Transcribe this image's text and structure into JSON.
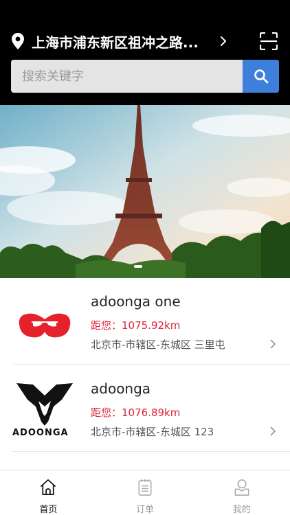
{
  "header": {
    "location": "上海市浦东新区祖冲之路...",
    "icons": {
      "pin": "location-pin-icon",
      "chevron": "chevron-right-icon",
      "scan": "scan-icon"
    }
  },
  "search": {
    "placeholder": "搜索关键字",
    "value": "",
    "button_icon": "search-icon",
    "accent": "#3f7fdc"
  },
  "banner": {
    "slide_count": 1,
    "active_slide": 1
  },
  "shops": [
    {
      "name": "adoonga one",
      "distance": "距您：1075.92km",
      "address": "北京市-市辖区-东城区 三里屯",
      "logo": "red-mustache-logo"
    },
    {
      "name": "adoonga",
      "distance": "距您：1076.89km",
      "address": "北京市-市辖区-东城区 123",
      "logo_text": "ADOONGA",
      "logo": "adoonga-emblem-logo"
    }
  ],
  "colors": {
    "distance": "#e0233a",
    "header_bg": "#000000"
  },
  "tabbar": {
    "tabs": [
      {
        "label": "首页",
        "icon": "home-icon",
        "active": true
      },
      {
        "label": "订单",
        "icon": "order-icon",
        "active": false
      },
      {
        "label": "我的",
        "icon": "profile-icon",
        "active": false
      }
    ]
  }
}
